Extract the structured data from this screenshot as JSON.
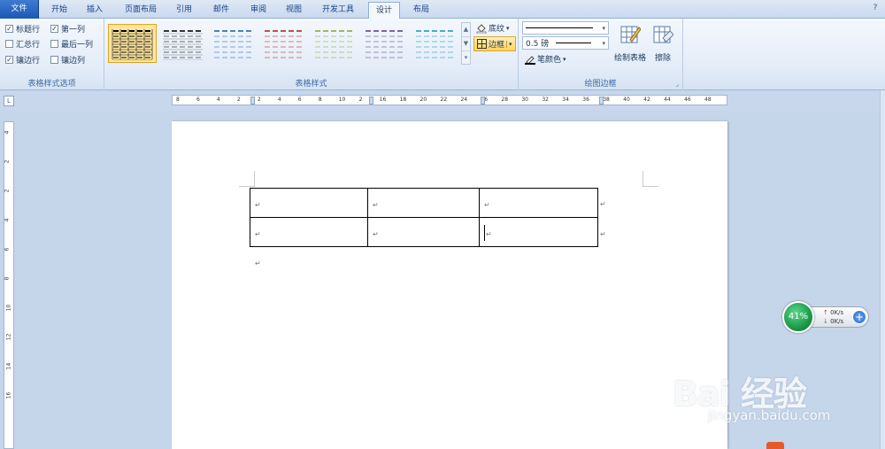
{
  "tabs": [
    {
      "label": "文件",
      "name": "tab-file"
    },
    {
      "label": "开始",
      "name": "tab-home"
    },
    {
      "label": "插入",
      "name": "tab-insert"
    },
    {
      "label": "页面布局",
      "name": "tab-page-layout"
    },
    {
      "label": "引用",
      "name": "tab-references"
    },
    {
      "label": "邮件",
      "name": "tab-mailings"
    },
    {
      "label": "审阅",
      "name": "tab-review"
    },
    {
      "label": "视图",
      "name": "tab-view"
    },
    {
      "label": "开发工具",
      "name": "tab-developer"
    },
    {
      "label": "设计",
      "name": "tab-design"
    },
    {
      "label": "布局",
      "name": "tab-layout"
    }
  ],
  "active_tab": "设计",
  "style_options": {
    "group_label": "表格样式选项",
    "items": [
      {
        "label": "标题行",
        "checked": true
      },
      {
        "label": "第一列",
        "checked": true
      },
      {
        "label": "汇总行",
        "checked": false
      },
      {
        "label": "最后一列",
        "checked": false
      },
      {
        "label": "镶边行",
        "checked": true
      },
      {
        "label": "镶边列",
        "checked": false
      }
    ]
  },
  "table_styles": {
    "group_label": "表格样式",
    "shading_label": "底纹",
    "borders_label": "边框",
    "thumb_colors": [
      "#000000",
      "#333333",
      "#4f81bd",
      "#c0504d",
      "#9bbb59",
      "#8064a2",
      "#4bacc6"
    ]
  },
  "draw_borders": {
    "group_label": "绘图边框",
    "line_weight": "0.5 磅",
    "pen_color_label": "笔颜色",
    "draw_table_label": "绘制表格",
    "eraser_label": "擦除"
  },
  "ruler": {
    "h_numbers": [
      "8",
      "6",
      "4",
      "2",
      "2",
      "4",
      "6",
      "8",
      "10",
      "2",
      "16",
      "18",
      "20",
      "22",
      "24",
      "26",
      "28",
      "30",
      "32",
      "34",
      "36",
      "38",
      "40",
      "42",
      "44",
      "46",
      "48"
    ],
    "v_numbers": [
      "4",
      "2",
      "2",
      "4",
      "6",
      "8",
      "10",
      "12",
      "14",
      "16"
    ]
  },
  "document": {
    "paragraph_mark": "↵",
    "table_rows": 2,
    "table_cols": 3
  },
  "net_widget": {
    "percent": "41%",
    "upload": "0K/s",
    "download": "0K/s"
  },
  "watermark": {
    "brand": "Bai 经验",
    "url": "jingyan.baidu.com"
  }
}
